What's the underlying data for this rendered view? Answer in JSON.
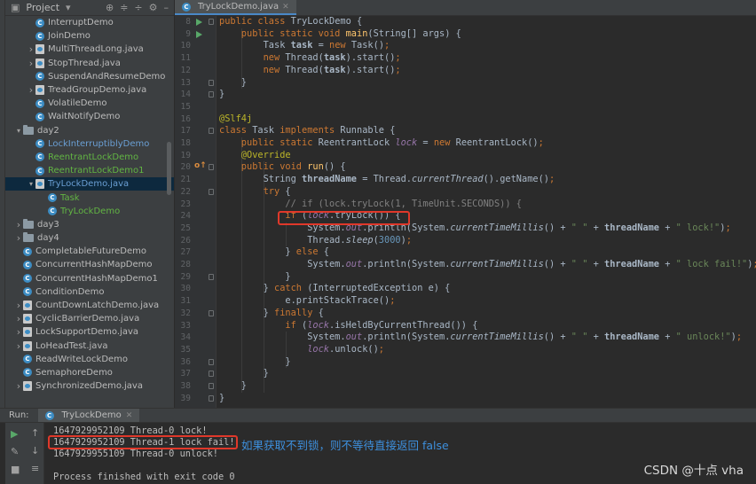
{
  "project_panel": {
    "title": "Project",
    "items": [
      {
        "label": "InterruptDemo",
        "kind": "class",
        "indent": 2,
        "color": "default"
      },
      {
        "label": "JoinDemo",
        "kind": "class",
        "indent": 2,
        "color": "default"
      },
      {
        "label": "MultiThreadLong.java",
        "kind": "file",
        "indent": 2,
        "color": "default",
        "expandable": true
      },
      {
        "label": "StopThread.java",
        "kind": "file",
        "indent": 2,
        "color": "default",
        "expandable": true
      },
      {
        "label": "SuspendAndResumeDemo",
        "kind": "class",
        "indent": 2,
        "color": "default"
      },
      {
        "label": "TreadGroupDemo.java",
        "kind": "file",
        "indent": 2,
        "color": "default",
        "expandable": true
      },
      {
        "label": "VolatileDemo",
        "kind": "class",
        "indent": 2,
        "color": "default"
      },
      {
        "label": "WaitNotifyDemo",
        "kind": "class",
        "indent": 2,
        "color": "default"
      },
      {
        "label": "day2",
        "kind": "folder",
        "indent": 1,
        "color": "default",
        "expanded": true
      },
      {
        "label": "LockInterruptiblyDemo",
        "kind": "class",
        "indent": 2,
        "color": "blue"
      },
      {
        "label": "ReentrantLockDemo",
        "kind": "class",
        "indent": 2,
        "color": "green"
      },
      {
        "label": "ReentrantLockDemo1",
        "kind": "class",
        "indent": 2,
        "color": "green"
      },
      {
        "label": "TryLockDemo.java",
        "kind": "file",
        "indent": 2,
        "color": "blue",
        "expanded": true,
        "selected": true
      },
      {
        "label": "Task",
        "kind": "class",
        "indent": 3,
        "color": "green"
      },
      {
        "label": "TryLockDemo",
        "kind": "class",
        "indent": 3,
        "color": "green"
      },
      {
        "label": "day3",
        "kind": "folder",
        "indent": 1,
        "color": "default",
        "expandable": true
      },
      {
        "label": "day4",
        "kind": "folder",
        "indent": 1,
        "color": "default",
        "expandable": true
      },
      {
        "label": "CompletableFutureDemo",
        "kind": "class",
        "indent": 1,
        "color": "default"
      },
      {
        "label": "ConcurrentHashMapDemo",
        "kind": "class",
        "indent": 1,
        "color": "default"
      },
      {
        "label": "ConcurrentHashMapDemo1",
        "kind": "class",
        "indent": 1,
        "color": "default"
      },
      {
        "label": "ConditionDemo",
        "kind": "class",
        "indent": 1,
        "color": "default"
      },
      {
        "label": "CountDownLatchDemo.java",
        "kind": "file",
        "indent": 1,
        "color": "default",
        "expandable": true
      },
      {
        "label": "CyclicBarrierDemo.java",
        "kind": "file",
        "indent": 1,
        "color": "default",
        "expandable": true
      },
      {
        "label": "LockSupportDemo.java",
        "kind": "file",
        "indent": 1,
        "color": "default",
        "expandable": true
      },
      {
        "label": "LoHeadTest.java",
        "kind": "file",
        "indent": 1,
        "color": "default",
        "expandable": true
      },
      {
        "label": "ReadWriteLockDemo",
        "kind": "class",
        "indent": 1,
        "color": "default"
      },
      {
        "label": "SemaphoreDemo",
        "kind": "class",
        "indent": 1,
        "color": "default"
      },
      {
        "label": "SynchronizedDemo.java",
        "kind": "file",
        "indent": 1,
        "color": "default",
        "expandable": true
      }
    ]
  },
  "editor": {
    "tab_label": "TryLockDemo.java",
    "line_numbers": [
      "8",
      "9",
      "10",
      "11",
      "12",
      "13",
      "14",
      "15",
      "16",
      "17",
      "18",
      "19",
      "20",
      "21",
      "22",
      "23",
      "24",
      "25",
      "26",
      "27",
      "28",
      "29",
      "30",
      "31",
      "32",
      "33",
      "34",
      "35",
      "36",
      "37",
      "38",
      "39"
    ],
    "run_marker_lines": [
      "8",
      "9"
    ],
    "override_marker_lines": [
      "20"
    ],
    "code_lines": [
      [
        [
          "kw",
          "public class "
        ],
        [
          "tx",
          "TryLockDemo {"
        ]
      ],
      [
        [
          "kw",
          "    public static void "
        ],
        [
          "fn",
          "main"
        ],
        [
          "tx",
          "(String[] args) {"
        ]
      ],
      [
        [
          "tx",
          "        Task "
        ],
        [
          "tx-b",
          "task"
        ],
        [
          "tx",
          " = "
        ],
        [
          "kw",
          "new "
        ],
        [
          "tx",
          "Task()"
        ],
        [
          "kw",
          ";"
        ]
      ],
      [
        [
          "kw",
          "        new "
        ],
        [
          "tx",
          "Thread("
        ],
        [
          "tx-b",
          "task"
        ],
        [
          "tx",
          ").start()"
        ],
        [
          "kw",
          ";"
        ]
      ],
      [
        [
          "kw",
          "        new "
        ],
        [
          "tx",
          "Thread("
        ],
        [
          "tx-b",
          "task"
        ],
        [
          "tx",
          ").start()"
        ],
        [
          "kw",
          ";"
        ]
      ],
      [
        [
          "tx",
          "    }"
        ]
      ],
      [
        [
          "tx",
          "}"
        ]
      ],
      [],
      [
        [
          "an",
          "@Slf4j"
        ]
      ],
      [
        [
          "kw",
          "class "
        ],
        [
          "tx",
          "Task "
        ],
        [
          "kw",
          "implements "
        ],
        [
          "tx",
          "Runnable {"
        ]
      ],
      [
        [
          "kw",
          "    public static "
        ],
        [
          "tx",
          "ReentrantLock "
        ],
        [
          "sf",
          "lock"
        ],
        [
          "tx",
          " = "
        ],
        [
          "kw",
          "new "
        ],
        [
          "tx",
          "ReentrantLock()"
        ],
        [
          "kw",
          ";"
        ]
      ],
      [
        [
          "an",
          "    @Override"
        ]
      ],
      [
        [
          "kw",
          "    public void "
        ],
        [
          "fn",
          "run"
        ],
        [
          "tx",
          "() {"
        ]
      ],
      [
        [
          "tx",
          "        String "
        ],
        [
          "tx-b",
          "threadName"
        ],
        [
          "tx",
          " = Thread."
        ],
        [
          "it",
          "currentThread"
        ],
        [
          "tx",
          "().getName()"
        ],
        [
          "kw",
          ";"
        ]
      ],
      [
        [
          "kw",
          "        try "
        ],
        [
          "tx",
          "{"
        ]
      ],
      [
        [
          "cm",
          "            // if (lock.tryLock(1, TimeUnit.SECONDS)) {"
        ]
      ],
      [
        [
          "kw",
          "            if "
        ],
        [
          "tx",
          "("
        ],
        [
          "sf",
          "lock"
        ],
        [
          "tx",
          ".tryLock()) {"
        ]
      ],
      [
        [
          "tx",
          "                System."
        ],
        [
          "sf",
          "out"
        ],
        [
          "tx",
          ".println(System."
        ],
        [
          "it",
          "currentTimeMillis"
        ],
        [
          "tx",
          "() + "
        ],
        [
          "st",
          "\" \""
        ],
        [
          "tx",
          " + "
        ],
        [
          "tx-b",
          "threadName"
        ],
        [
          "tx",
          " + "
        ],
        [
          "st",
          "\" lock!\""
        ],
        [
          "tx",
          ")"
        ],
        [
          "kw",
          ";"
        ]
      ],
      [
        [
          "tx",
          "                Thread."
        ],
        [
          "it",
          "sleep"
        ],
        [
          "tx",
          "("
        ],
        [
          "nm",
          "3000"
        ],
        [
          "tx",
          ")"
        ],
        [
          "kw",
          ";"
        ]
      ],
      [
        [
          "tx",
          "            } "
        ],
        [
          "kw",
          "else "
        ],
        [
          "tx",
          "{"
        ]
      ],
      [
        [
          "tx",
          "                System."
        ],
        [
          "sf",
          "out"
        ],
        [
          "tx",
          ".println(System."
        ],
        [
          "it",
          "currentTimeMillis"
        ],
        [
          "tx",
          "() + "
        ],
        [
          "st",
          "\" \""
        ],
        [
          "tx",
          " + "
        ],
        [
          "tx-b",
          "threadName"
        ],
        [
          "tx",
          " + "
        ],
        [
          "st",
          "\" lock fail!\""
        ],
        [
          "tx",
          ")"
        ],
        [
          "kw",
          ";"
        ]
      ],
      [
        [
          "tx",
          "            }"
        ]
      ],
      [
        [
          "tx",
          "        } "
        ],
        [
          "kw",
          "catch "
        ],
        [
          "tx",
          "(InterruptedException e) {"
        ]
      ],
      [
        [
          "tx",
          "            e.printStackTrace()"
        ],
        [
          "kw",
          ";"
        ]
      ],
      [
        [
          "tx",
          "        } "
        ],
        [
          "kw",
          "finally "
        ],
        [
          "tx",
          "{"
        ]
      ],
      [
        [
          "kw",
          "            if "
        ],
        [
          "tx",
          "("
        ],
        [
          "sf",
          "lock"
        ],
        [
          "tx",
          ".isHeldByCurrentThread()) {"
        ]
      ],
      [
        [
          "tx",
          "                System."
        ],
        [
          "sf",
          "out"
        ],
        [
          "tx",
          ".println(System."
        ],
        [
          "it",
          "currentTimeMillis"
        ],
        [
          "tx",
          "() + "
        ],
        [
          "st",
          "\" \""
        ],
        [
          "tx",
          " + "
        ],
        [
          "tx-b",
          "threadName"
        ],
        [
          "tx",
          " + "
        ],
        [
          "st",
          "\" unlock!\""
        ],
        [
          "tx",
          ")"
        ],
        [
          "kw",
          ";"
        ]
      ],
      [
        [
          "sf",
          "                lock"
        ],
        [
          "tx",
          ".unlock()"
        ],
        [
          "kw",
          ";"
        ]
      ],
      [
        [
          "tx",
          "            }"
        ]
      ],
      [
        [
          "tx",
          "        }"
        ]
      ],
      [
        [
          "tx",
          "    }"
        ]
      ],
      [
        [
          "tx",
          "}"
        ]
      ]
    ]
  },
  "run_panel": {
    "label": "Run:",
    "config_name": "TryLockDemo",
    "console_lines": [
      "1647929952109 Thread-0 lock!",
      "1647929952109 Thread-1 lock fail!",
      "1647929955109 Thread-0 unlock!",
      "",
      "Process finished with exit code 0"
    ]
  },
  "annotation": "如果获取不到锁，则不等待直接返回 false",
  "watermark": "CSDN @十点 vha"
}
